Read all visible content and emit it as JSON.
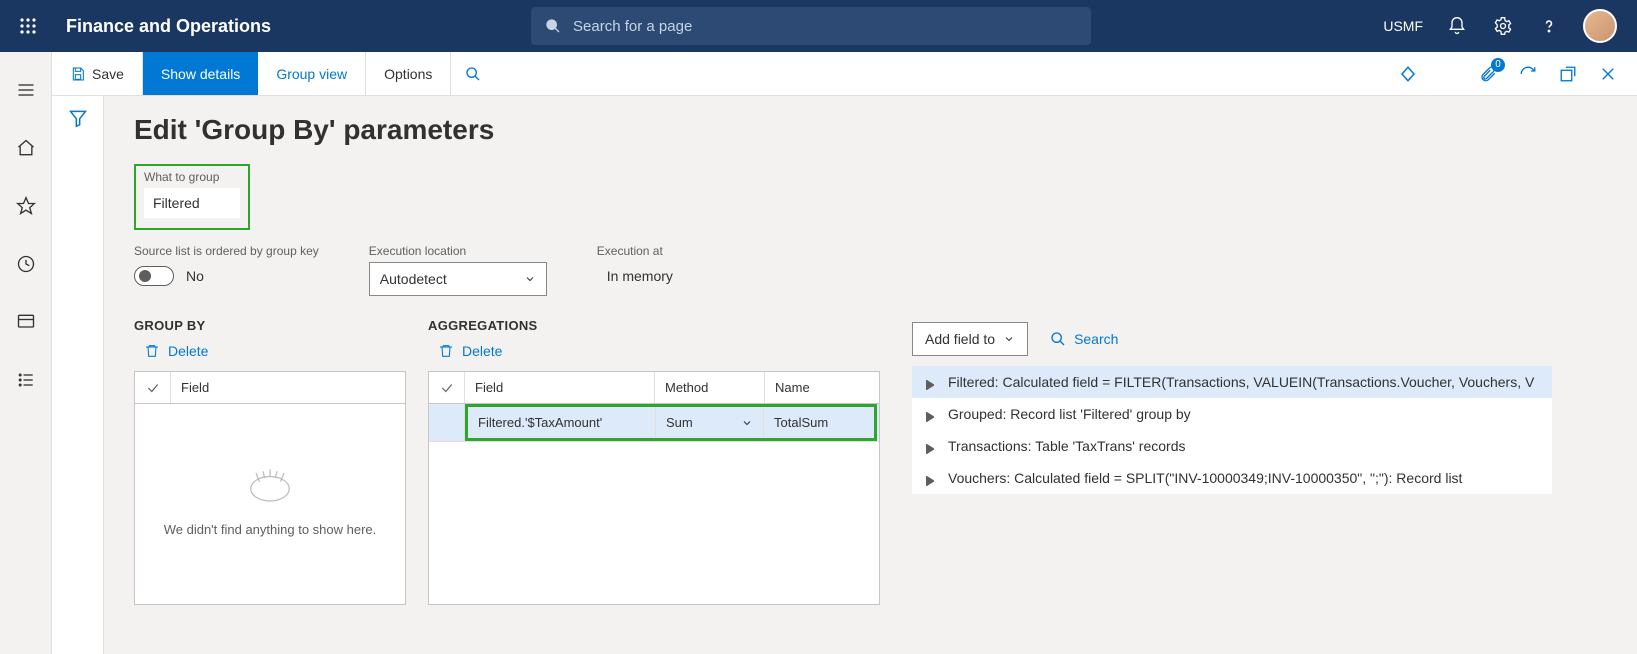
{
  "header": {
    "app_title": "Finance and Operations",
    "search_placeholder": "Search for a page",
    "legal_entity": "USMF"
  },
  "actionbar": {
    "save": "Save",
    "show_details": "Show details",
    "group_view": "Group view",
    "options": "Options",
    "attachments_count": "0"
  },
  "page": {
    "title": "Edit 'Group By' parameters",
    "what_to_group_label": "What to group",
    "what_to_group_value": "Filtered",
    "source_ordered_label": "Source list is ordered by group key",
    "source_ordered_value": "No",
    "exec_location_label": "Execution location",
    "exec_location_value": "Autodetect",
    "exec_at_label": "Execution at",
    "exec_at_value": "In memory"
  },
  "groupby": {
    "heading": "GROUP BY",
    "delete": "Delete",
    "col_field": "Field",
    "empty_text": "We didn't find anything to show here."
  },
  "aggs": {
    "heading": "AGGREGATIONS",
    "delete": "Delete",
    "col_field": "Field",
    "col_method": "Method",
    "col_name": "Name",
    "rows": [
      {
        "field": "Filtered.'$TaxAmount'",
        "method": "Sum",
        "name": "TotalSum"
      }
    ]
  },
  "right": {
    "add_field": "Add field to",
    "search": "Search",
    "tree": [
      "Filtered: Calculated field = FILTER(Transactions, VALUEIN(Transactions.Voucher, Vouchers, V",
      "Grouped: Record list 'Filtered' group by",
      "Transactions: Table 'TaxTrans' records",
      "Vouchers: Calculated field = SPLIT(\"INV-10000349;INV-10000350\", \";\"): Record list"
    ]
  }
}
